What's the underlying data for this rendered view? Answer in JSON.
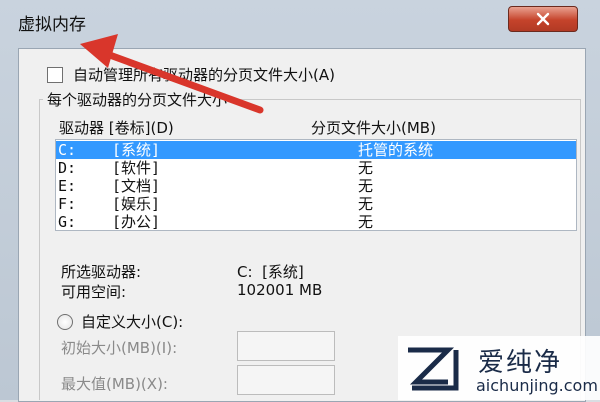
{
  "window": {
    "title": "虚拟内存",
    "close_label": "close"
  },
  "auto_manage": {
    "label": "自动管理所有驱动器的分页文件大小(A)",
    "checked": false
  },
  "group": {
    "label": "每个驱动器的分页文件大小",
    "columns": [
      "驱动器 [卷标](D)",
      "分页文件大小(MB)"
    ],
    "rows": [
      {
        "drive": "C:",
        "label": "[系统]",
        "size": "托管的系统",
        "selected": true
      },
      {
        "drive": "D:",
        "label": "[软件]",
        "size": "无",
        "selected": false
      },
      {
        "drive": "E:",
        "label": "[文档]",
        "size": "无",
        "selected": false
      },
      {
        "drive": "F:",
        "label": "[娱乐]",
        "size": "无",
        "selected": false
      },
      {
        "drive": "G:",
        "label": "[办公]",
        "size": "无",
        "selected": false
      }
    ]
  },
  "selected_info": {
    "drive_label": "所选驱动器:",
    "drive_value": "C:  [系统]",
    "space_label": "可用空间:",
    "space_value": "102001 MB"
  },
  "custom": {
    "radio_label": "自定义大小(C):",
    "initial_label": "初始大小(MB)(I):",
    "max_label": "最大值(MB)(X):"
  },
  "watermark": {
    "name": "爱纯净",
    "url": "aichunjing.com"
  },
  "colors": {
    "selection": "#3399ff",
    "close_button": "#c5432b",
    "arrow": "#d9362b"
  }
}
